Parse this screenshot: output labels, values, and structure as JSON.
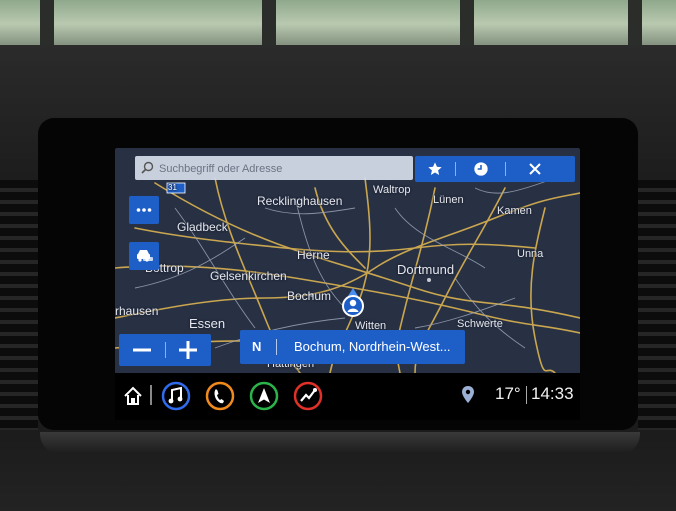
{
  "search": {
    "placeholder": "Suchbegriff oder Adresse"
  },
  "toolbar": {
    "favorites_icon": "star-icon",
    "recent_icon": "clock-icon",
    "close_icon": "close-icon"
  },
  "side_buttons": {
    "menu_icon": "more-dots-icon",
    "traffic_icon": "traffic-car-icon"
  },
  "map": {
    "road_shield": "31",
    "cities": {
      "waltrop": "Waltrop",
      "recklinghausen": "Recklinghausen",
      "luenen": "Lünen",
      "kamen": "Kamen",
      "gladbeck": "Gladbeck",
      "herne": "Herne",
      "unna": "Unna",
      "bottrop": "Bottrop",
      "gelsenkirchen": "Gelsenkirchen",
      "dortmund": "Dortmund",
      "bochum": "Bochum",
      "oberhausen": "rhausen",
      "essen": "Essen",
      "witten": "Witten",
      "schwerte": "Schwerte",
      "hattingen": "Hattingen"
    }
  },
  "zoom": {
    "out_label": "−",
    "in_label": "+"
  },
  "destination": {
    "heading": "N",
    "label": "Bochum, Nordrhein-West..."
  },
  "status": {
    "temperature": "17°",
    "time": "14:33"
  },
  "colors": {
    "accent": "#1e5fc7",
    "music": "#2f6bea",
    "phone": "#f08a1d",
    "nav": "#2bb34a",
    "projection": "#e0302a"
  }
}
